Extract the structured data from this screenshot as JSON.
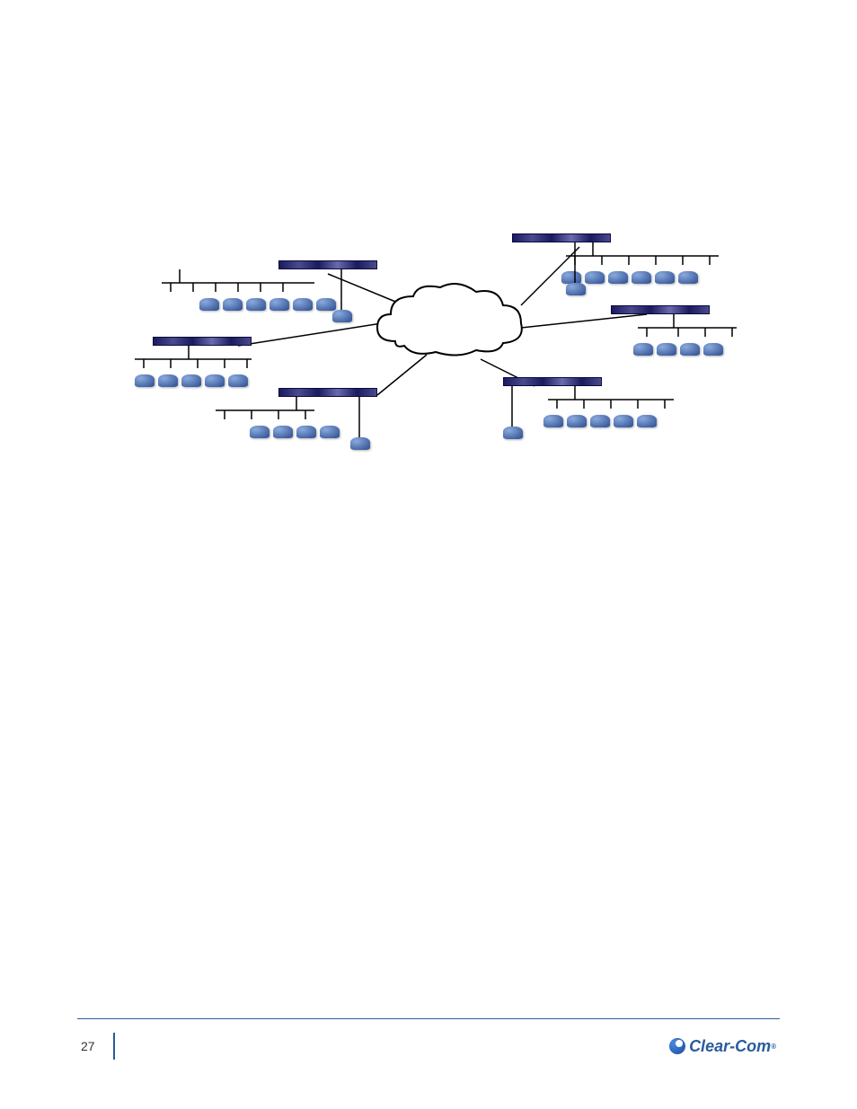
{
  "diagram": {
    "topology": "hub-and-spoke",
    "hub": "cloud",
    "peripheralGroups": [
      {
        "position": "top-left",
        "rackUnits": 6,
        "extraNode": true
      },
      {
        "position": "top-right",
        "rackUnits": 6,
        "extraNode": true
      },
      {
        "position": "left",
        "rackUnits": 5,
        "extraNode": false
      },
      {
        "position": "right",
        "rackUnits": 4,
        "extraNode": false
      },
      {
        "position": "bottom-left",
        "rackUnits": 4,
        "extraNode": true
      },
      {
        "position": "bottom-right",
        "rackUnits": 5,
        "extraNode": true
      }
    ]
  },
  "footer": {
    "pageNumber": "27",
    "brand": "Clear-Com"
  }
}
